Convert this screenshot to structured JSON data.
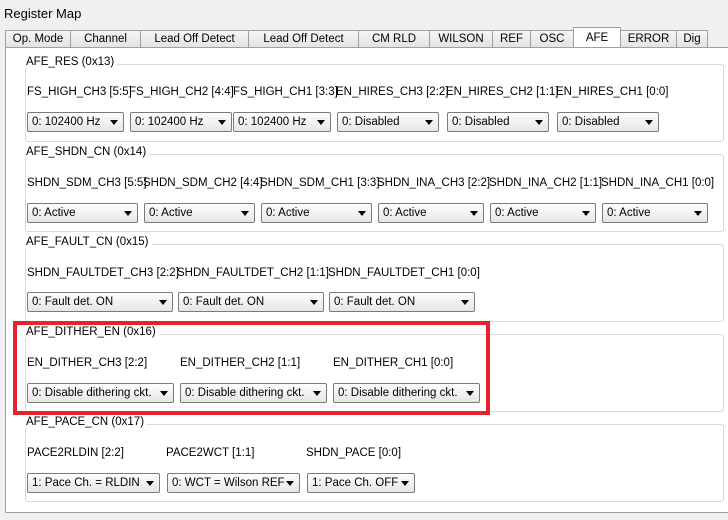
{
  "window": {
    "title": "Register Map"
  },
  "tabs": [
    {
      "label": "Op. Mode",
      "active": false
    },
    {
      "label": "Channel",
      "active": false
    },
    {
      "label": "Lead Off Detect",
      "active": false
    },
    {
      "label": "Lead Off Detect",
      "active": false
    },
    {
      "label": "CM RLD",
      "active": false
    },
    {
      "label": "WILSON",
      "active": false
    },
    {
      "label": "REF",
      "active": false
    },
    {
      "label": "OSC",
      "active": false
    },
    {
      "label": "AFE",
      "active": true
    },
    {
      "label": "ERROR",
      "active": false
    },
    {
      "label": "Dig",
      "active": false
    }
  ],
  "groups": {
    "afe_res": {
      "title": "AFE_RES (0x13)",
      "fields": [
        {
          "label": "FS_HIGH_CH3 [5:5]",
          "value": "0: 102400 Hz"
        },
        {
          "label": "FS_HIGH_CH2 [4:4]",
          "value": "0: 102400 Hz"
        },
        {
          "label": "FS_HIGH_CH1 [3:3]",
          "value": "0: 102400 Hz"
        },
        {
          "label": "EN_HIRES_CH3 [2:2]",
          "value": "0: Disabled"
        },
        {
          "label": "EN_HIRES_CH2 [1:1]",
          "value": "0: Disabled"
        },
        {
          "label": "EN_HIRES_CH1 [0:0]",
          "value": "0: Disabled"
        }
      ]
    },
    "afe_shdn_cn": {
      "title": "AFE_SHDN_CN (0x14)",
      "fields": [
        {
          "label": "SHDN_SDM_CH3 [5:5]",
          "value": "0: Active"
        },
        {
          "label": "SHDN_SDM_CH2 [4:4]",
          "value": "0: Active"
        },
        {
          "label": "SHDN_SDM_CH1 [3:3]",
          "value": "0: Active"
        },
        {
          "label": "SHDN_INA_CH3 [2:2]",
          "value": "0: Active"
        },
        {
          "label": "SHDN_INA_CH2 [1:1]",
          "value": "0: Active"
        },
        {
          "label": "SHDN_INA_CH1 [0:0]",
          "value": "0: Active"
        }
      ]
    },
    "afe_fault_cn": {
      "title": "AFE_FAULT_CN (0x15)",
      "fields": [
        {
          "label": "SHDN_FAULTDET_CH3 [2:2]",
          "value": "0: Fault det. ON"
        },
        {
          "label": "SHDN_FAULTDET_CH2 [1:1]",
          "value": "0: Fault det. ON"
        },
        {
          "label": "SHDN_FAULTDET_CH1 [0:0]",
          "value": "0: Fault det. ON"
        }
      ]
    },
    "afe_dither_en": {
      "title": "AFE_DITHER_EN (0x16)",
      "fields": [
        {
          "label": "EN_DITHER_CH3 [2:2]",
          "value": "0: Disable dithering ckt."
        },
        {
          "label": "EN_DITHER_CH2 [1:1]",
          "value": "0: Disable dithering ckt."
        },
        {
          "label": "EN_DITHER_CH1 [0:0]",
          "value": "0: Disable dithering ckt."
        }
      ]
    },
    "afe_pace_cn": {
      "title": "AFE_PACE_CN (0x17)",
      "fields": [
        {
          "label": "PACE2RLDIN [2:2]",
          "value": "1: Pace Ch. = RLDIN"
        },
        {
          "label": "PACE2WCT [1:1]",
          "value": "0: WCT = Wilson REF"
        },
        {
          "label": "SHDN_PACE [0:0]",
          "value": "1: Pace Ch. OFF"
        }
      ]
    }
  },
  "colors": {
    "highlight": "#e8212e",
    "panel_bg": "#ffffff",
    "window_bg": "#f0f0f0"
  }
}
